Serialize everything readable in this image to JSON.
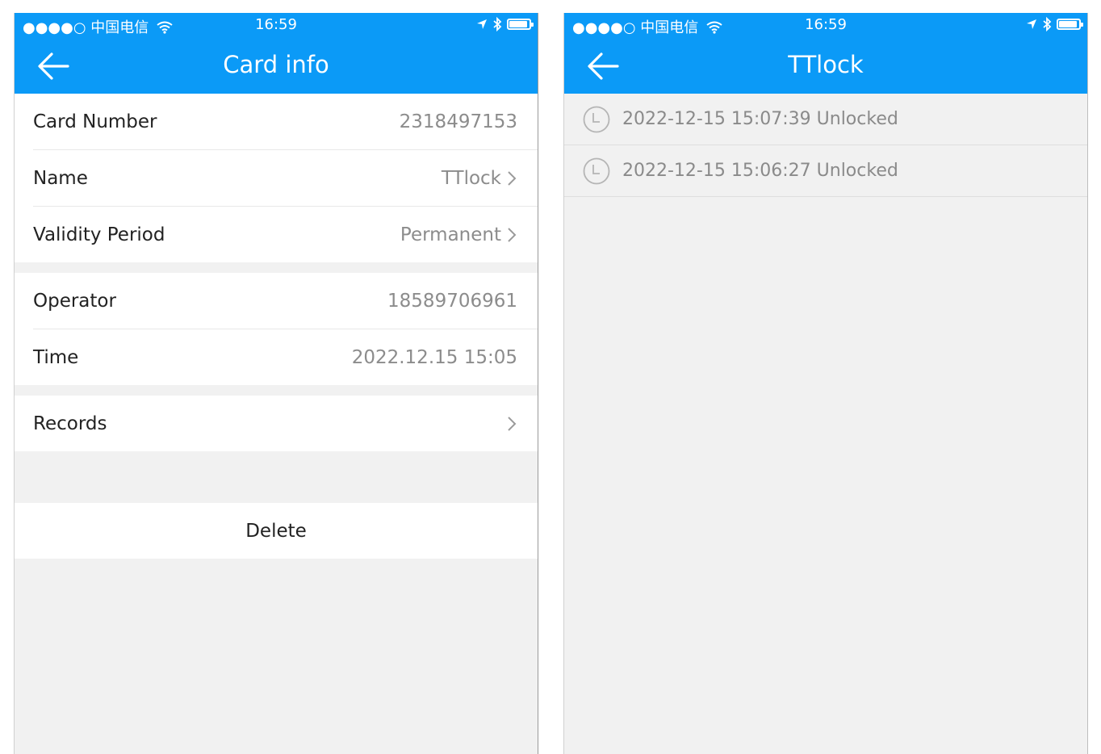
{
  "status": {
    "carrier": "●●●●○ 中国电信",
    "time": "16:59"
  },
  "card_info": {
    "title": "Card info",
    "rows": [
      {
        "label": "Card Number",
        "value": "2318497153"
      },
      {
        "label": "Name",
        "value": "TTlock"
      },
      {
        "label": "Validity Period",
        "value": "Permanent"
      },
      {
        "label": "Operator",
        "value": "18589706961"
      },
      {
        "label": "Time",
        "value": "2022.12.15 15:05"
      },
      {
        "label": "Records"
      }
    ],
    "delete_label": "Delete"
  },
  "records_screen": {
    "title": "TTlock",
    "records": [
      "2022-12-15 15:07:39 Unlocked",
      "2022-12-15 15:06:27 Unlocked"
    ]
  },
  "colors": {
    "header_bg": "#0b9af7",
    "page_bg": "#f1f1f1"
  },
  "icons": [
    "wifi-icon",
    "location-arrow-icon",
    "bluetooth-icon",
    "battery-icon",
    "back-arrow-icon",
    "chevron-right-icon",
    "clock-icon"
  ]
}
